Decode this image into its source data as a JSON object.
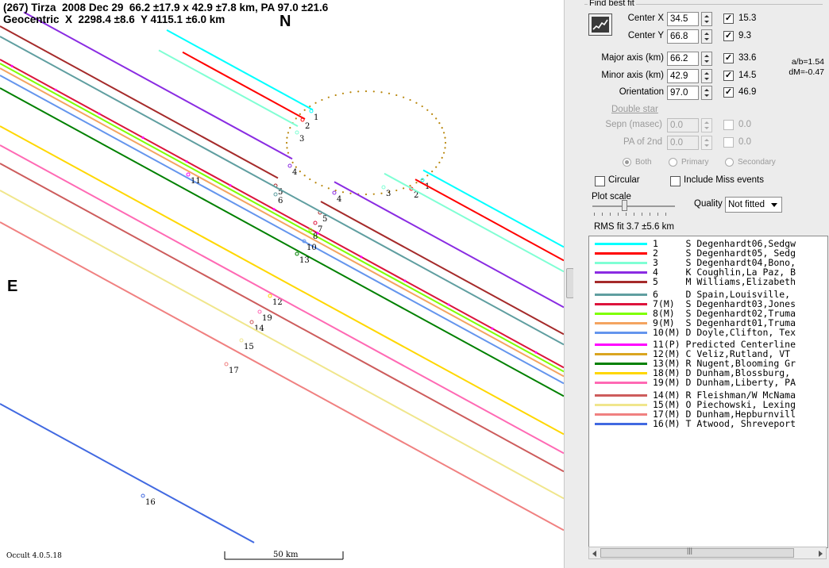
{
  "header": {
    "line1": "(267) Tirza  2008 Dec 29  66.2 ±17.9 x 42.9 ±7.8 km, PA 97.0 ±21.6",
    "line2": "Geocentric  X  2298.4 ±8.6  Y 4115.1 ±6.0 km"
  },
  "compass": {
    "north": "N",
    "east": "E"
  },
  "footer": {
    "version": "Occult 4.0.5.18",
    "scale_label": "50 km"
  },
  "fit": {
    "group_title": "Find best fit",
    "fit_button_icon": "fit-chart-icon",
    "fields": [
      {
        "label": "Center X",
        "value": "34.5",
        "checked": true,
        "uncertainty": "15.3"
      },
      {
        "label": "Center Y",
        "value": "66.8",
        "checked": true,
        "uncertainty": "9.3"
      },
      {
        "label": "Major axis (km)",
        "value": "66.2",
        "checked": true,
        "uncertainty": "33.6"
      },
      {
        "label": "Minor axis (km)",
        "value": "42.9",
        "checked": true,
        "uncertainty": "14.5"
      },
      {
        "label": "Orientation",
        "value": "97.0",
        "checked": true,
        "uncertainty": "46.9"
      }
    ],
    "ratio": "a/b=1.54",
    "dmag": "dM=-0.47",
    "double_star": {
      "link": "Double star",
      "sepn_label": "Sepn (masec)",
      "sepn_value": "0.0",
      "sepn_unc": "0.0",
      "pa_label": "PA of 2nd",
      "pa_value": "0.0",
      "pa_unc": "0.0",
      "radios": [
        "Both",
        "Primary",
        "Secondary"
      ]
    },
    "circular_label": "Circular",
    "include_miss_label": "Include Miss events",
    "plot_scale_label": "Plot scale",
    "quality_label": "Quality",
    "quality_value": "Not fitted",
    "rms_fit": "RMS fit 3.7 ±5.6 km"
  },
  "legend": [
    {
      "text": "1     S Degenhardt06,Sedgw",
      "color": "#00ffff"
    },
    {
      "text": "2     S Degenhardt05, Sedg",
      "color": "#ff0000"
    },
    {
      "text": "3     S Degenhardt04,Bono,",
      "color": "#7fffd4"
    },
    {
      "text": "4     K Coughlin,La Paz, B",
      "color": "#8a2be2"
    },
    {
      "text": "5     M Williams,Elizabeth",
      "color": "#a52a2a"
    },
    {
      "text": "6     D Spain,Louisville, ",
      "color": "#5f9ea0"
    },
    {
      "text": "7(M)  S Degenhardt03,Jones",
      "color": "#dc143c"
    },
    {
      "text": "8(M)  S Degenhardt02,Truma",
      "color": "#7fff00"
    },
    {
      "text": "9(M)  S Degenhardt01,Truma",
      "color": "#f4a460"
    },
    {
      "text": "10(M) D Doyle,Clifton, Tex",
      "color": "#6495ed"
    },
    {
      "text": "11(P) Predicted Centerline",
      "color": "#ff00ff"
    },
    {
      "text": "12(M) C Veliz,Rutland, VT ",
      "color": "#daa520"
    },
    {
      "text": "13(M) R Nugent,Blooming Gr",
      "color": "#008000"
    },
    {
      "text": "18(M) D Dunham,Blossburg, ",
      "color": "#ffd700"
    },
    {
      "text": "19(M) D Dunham,Liberty, PA",
      "color": "#ff69b4"
    },
    {
      "text": "14(M) R Fleishman/W McNama",
      "color": "#cd5c5c"
    },
    {
      "text": "15(M) O Piechowski, Lexing",
      "color": "#f0e68c"
    },
    {
      "text": "17(M) D Dunham,Hepburnvill",
      "color": "#f08080"
    },
    {
      "text": "16(M) T Atwood, Shreveport",
      "color": "#4169e1"
    }
  ],
  "chords": [
    {
      "id": "1",
      "color": "#00ffff",
      "hits": [
        {
          "label": "1"
        },
        {
          "label": "1"
        }
      ]
    },
    {
      "id": "2",
      "color": "#ff0000",
      "hits": [
        {
          "label": "2"
        },
        {
          "label": "2"
        }
      ]
    },
    {
      "id": "3",
      "color": "#7fffd4",
      "hits": [
        {
          "label": "3"
        },
        {
          "label": "3"
        }
      ]
    },
    {
      "id": "4",
      "color": "#8a2be2",
      "hits": [
        {
          "label": "4"
        },
        {
          "label": "4"
        }
      ]
    },
    {
      "id": "5",
      "color": "#a52a2a",
      "hits": [
        {
          "label": "5"
        },
        {
          "label": "5"
        }
      ]
    },
    {
      "id": "6",
      "color": "#5f9ea0",
      "hits": [
        {
          "label": "6"
        }
      ]
    },
    {
      "id": "7",
      "color": "#dc143c",
      "hits": [
        {
          "label": "7"
        }
      ]
    },
    {
      "id": "8",
      "color": "#7fff00",
      "hits": [
        {
          "label": "8"
        }
      ]
    },
    {
      "id": "9",
      "color": "#f4a460",
      "hits": []
    },
    {
      "id": "10",
      "color": "#6495ed",
      "hits": [
        {
          "label": "10"
        }
      ]
    },
    {
      "id": "11",
      "color": "#ff00ff",
      "hits": [
        {
          "label": "11"
        }
      ]
    },
    {
      "id": "13",
      "color": "#008000",
      "hits": [
        {
          "label": "13"
        }
      ]
    },
    {
      "id": "12",
      "color": "#ffd700",
      "hits": [
        {
          "label": "12"
        }
      ]
    },
    {
      "id": "19",
      "color": "#ff69b4",
      "hits": [
        {
          "label": "19"
        }
      ]
    },
    {
      "id": "14",
      "color": "#cd5c5c",
      "hits": [
        {
          "label": "14"
        }
      ]
    },
    {
      "id": "15",
      "color": "#f0e68c",
      "hits": [
        {
          "label": "15"
        }
      ]
    },
    {
      "id": "17",
      "color": "#f08080",
      "hits": [
        {
          "label": "17"
        }
      ]
    },
    {
      "id": "16",
      "color": "#4169e1",
      "hits": [
        {
          "label": "16"
        }
      ]
    }
  ]
}
